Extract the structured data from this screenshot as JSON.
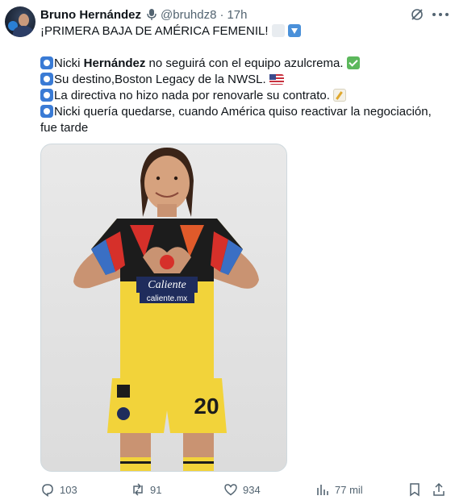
{
  "author": {
    "name": "Bruno Hernández",
    "handle": "@bruhdz8",
    "separator": "·",
    "time": "17h"
  },
  "tweet": {
    "headline": "¡PRIMERA BAJA DE AMÉRICA FEMENIL!",
    "line1_pre": "Nicki ",
    "line1_bold": "Hernández",
    "line1_post": " no seguirá con el equipo azulcrema.",
    "line2": "Su destino,Boston Legacy de la NWSL.",
    "line3": "La directiva no hizo nada por renovarle su contrato.",
    "line4": "Nicki quería quedarse, cuando América quiso reactivar la negociación, fue tarde"
  },
  "media": {
    "sponsor_main": "Caliente",
    "sponsor_url": "caliente.mx",
    "shorts_number": "20"
  },
  "actions": {
    "replies": "103",
    "reposts": "91",
    "likes": "934",
    "views": "77 mil"
  },
  "icons": [
    "mic-icon",
    "grok-icon",
    "more-icon",
    "reply-icon",
    "repost-icon",
    "like-icon",
    "views-icon",
    "bookmark-icon",
    "share-icon"
  ],
  "colors": {
    "text_primary": "#0f1419",
    "text_secondary": "#536471",
    "jersey_yellow": "#f2d33a",
    "jersey_navy": "#1f2c5c"
  }
}
